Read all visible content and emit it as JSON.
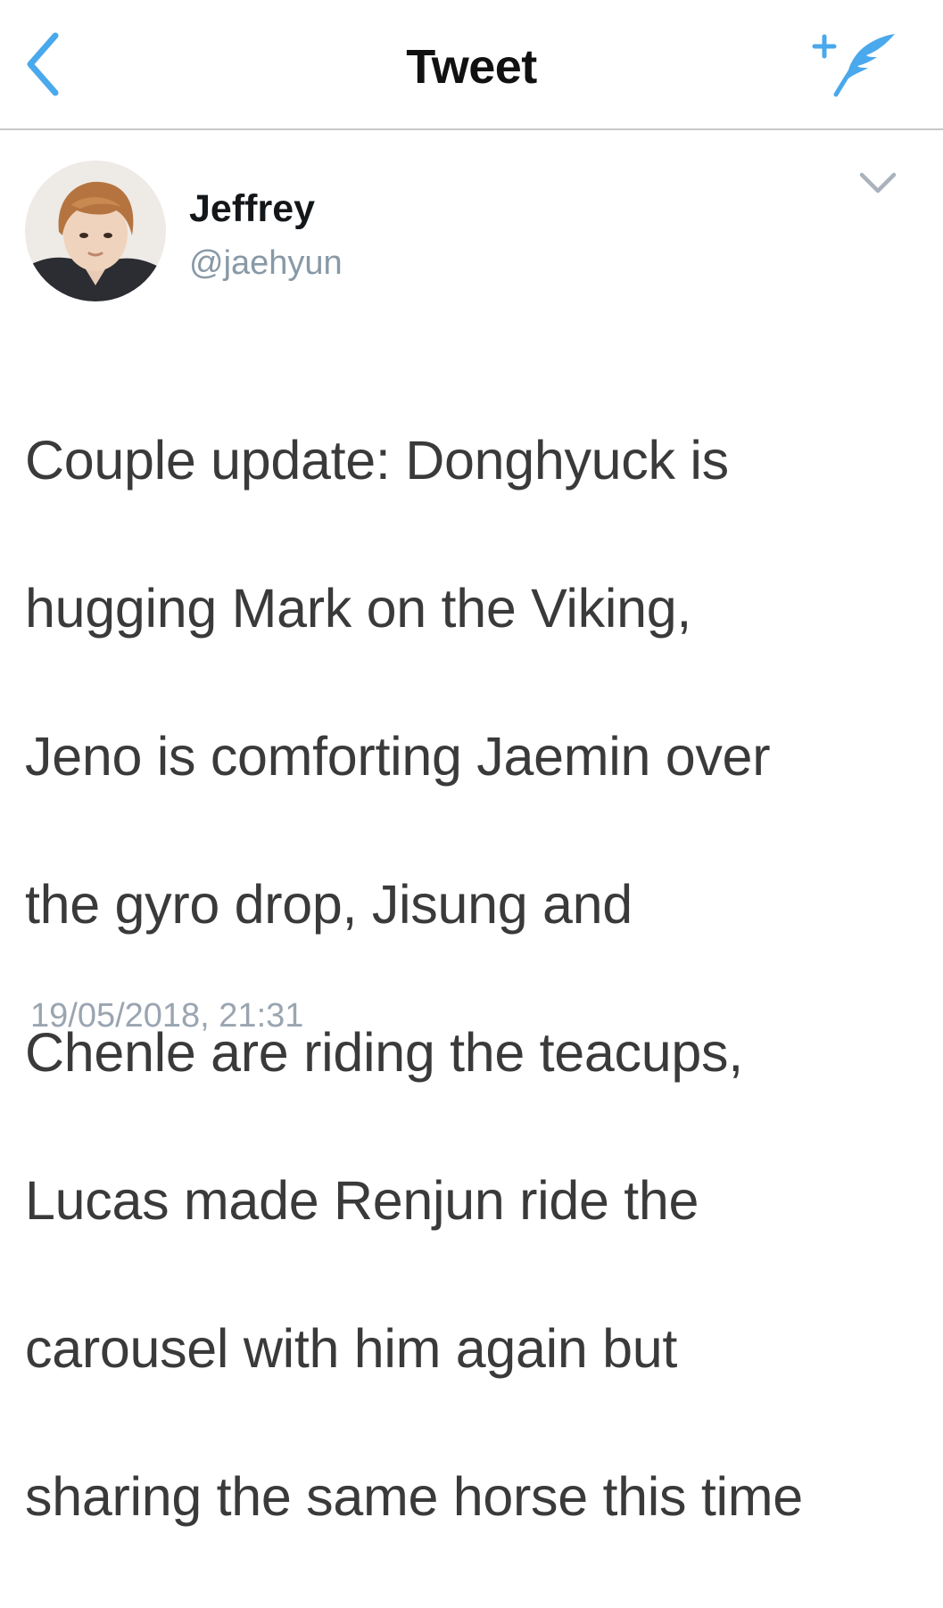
{
  "nav": {
    "title": "Tweet",
    "back_icon": "chevron-left-icon",
    "compose_icon": "compose-tweet-icon",
    "accent_color": "#4aa8ec"
  },
  "tweet": {
    "avatar_icon": "profile-photo",
    "display_name": "Jeffrey",
    "handle": "@jaehyun",
    "menu_icon": "chevron-down-icon",
    "text_lines": [
      "Couple update: Donghyuck is",
      "hugging Mark on the Viking,",
      "Jeno is comforting Jaemin over",
      "the gyro drop, Jisung and",
      "Chenle are riding the teacups,",
      "Lucas made Renjun ride the",
      "carousel with him again but",
      "sharing the same horse this time"
    ],
    "timestamp": "19/05/2018, 21:31"
  }
}
